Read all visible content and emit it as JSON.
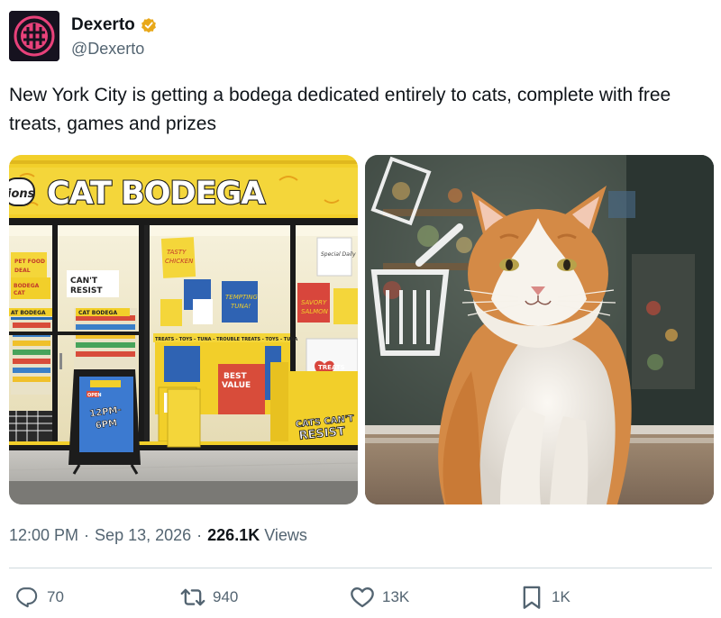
{
  "author": {
    "display_name": "Dexerto",
    "handle": "@Dexerto",
    "avatar_icon": "dexerto-logo-icon",
    "verified_icon": "gold-verified-badge-icon",
    "verified_color": "#e8a81a"
  },
  "tweet": {
    "text": "New York City is getting a bodega dedicated entirely to cats, complete with free treats, games and prizes"
  },
  "media": {
    "left_photo": {
      "sign": "CAT BODEGA",
      "sign_left_fragment": "ions",
      "poster_signs": [
        "PET FOOD DEAL",
        "BODEGA CAT",
        "CAN'T RESIST",
        "TASTY CHICKEN",
        "Special Daily",
        "TEMPTING TUNA!",
        "SAVORY SALMON",
        "BEST VALUE",
        "TREATS",
        "CATS CAN'T RESIST",
        "CAT BODEGA",
        "TREATS - TOYS - TUNA - TROUBLE"
      ],
      "sandwich_board": {
        "label": "OPEN",
        "hours": "12PM-6PM"
      }
    },
    "right_photo": {
      "subject": "orange-and-white-cat"
    }
  },
  "meta": {
    "time": "12:00 PM",
    "separator": "·",
    "date": "Sep 13, 2026",
    "views_count": "226.1K",
    "views_label": "Views"
  },
  "actions": {
    "replies": "70",
    "retweets": "940",
    "likes": "13K",
    "bookmarks": "1K"
  },
  "colors": {
    "text_primary": "#0f1419",
    "text_secondary": "#536471",
    "divider": "#cfd9de",
    "store_yellow": "#f2cf2a"
  }
}
